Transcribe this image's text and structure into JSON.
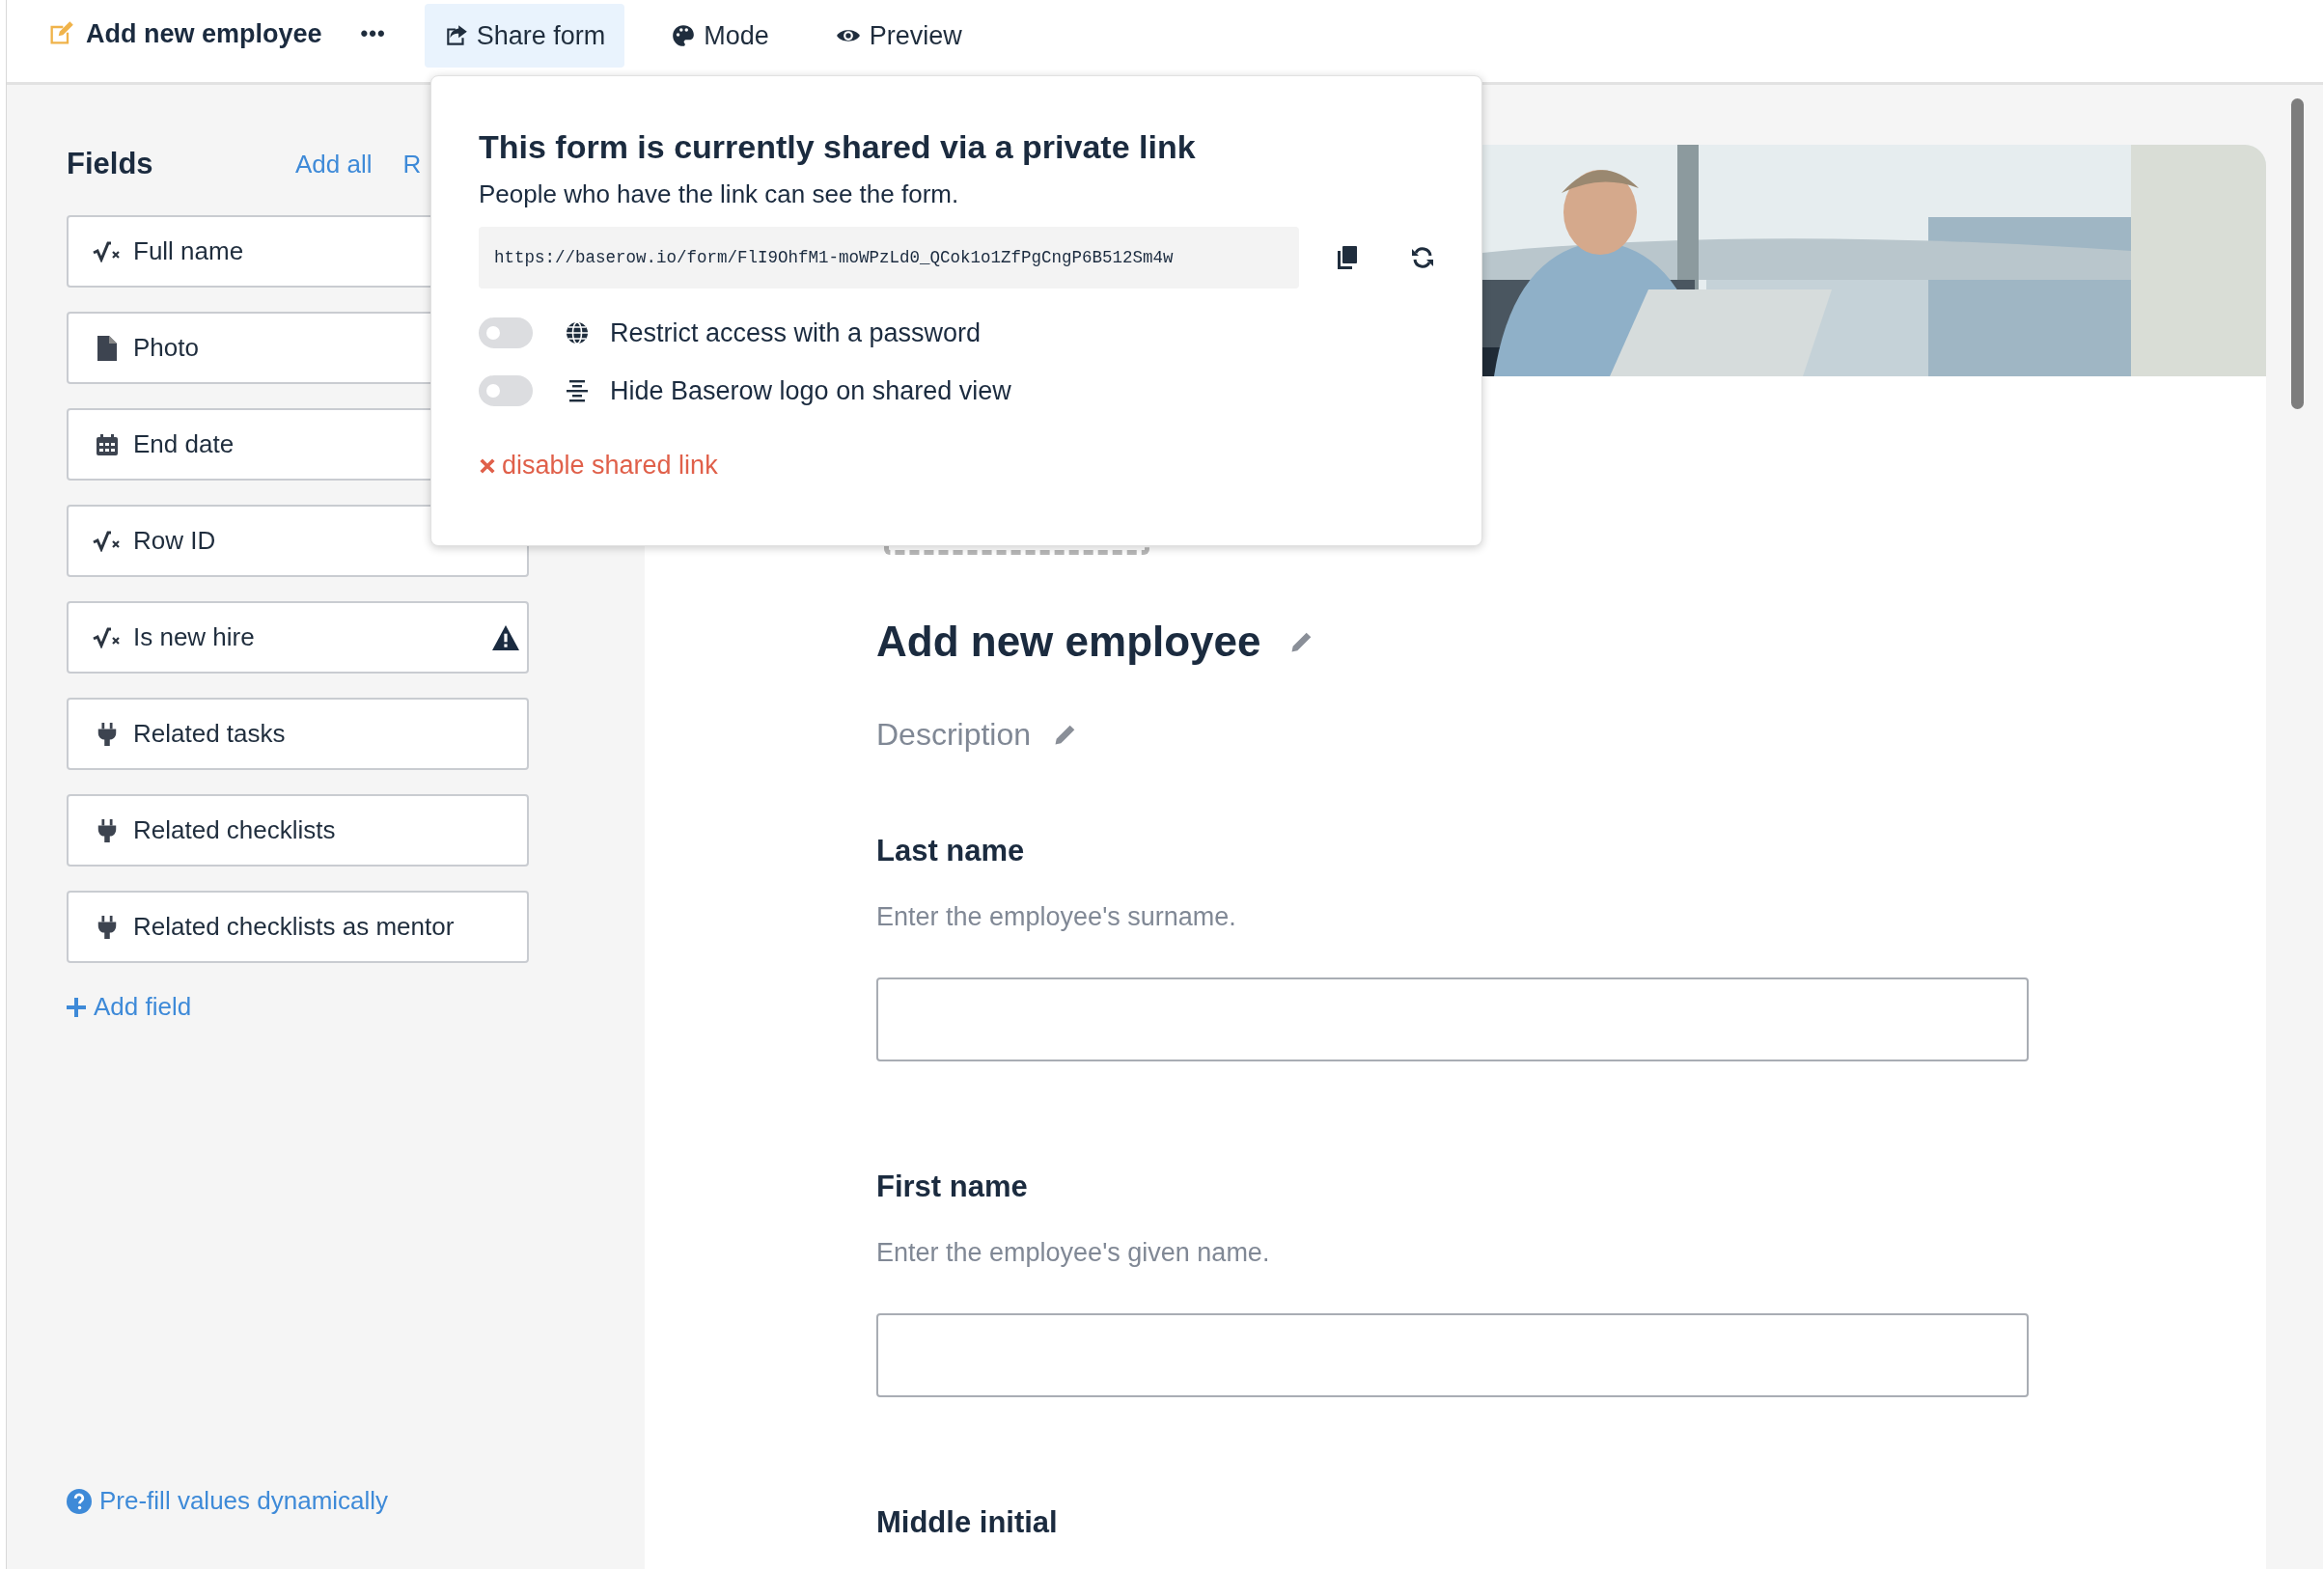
{
  "toolbar": {
    "title": "Add new employee",
    "more": "•••",
    "items": [
      {
        "label": "Share form",
        "selected": true
      },
      {
        "label": "Mode",
        "selected": false
      },
      {
        "label": "Preview",
        "selected": false
      }
    ]
  },
  "sidebar": {
    "heading": "Fields",
    "add_all": "Add all",
    "remove_all": "R",
    "fields": [
      {
        "name": "Full name",
        "kind": "formula"
      },
      {
        "name": "Photo",
        "kind": "file"
      },
      {
        "name": "End date",
        "kind": "date"
      },
      {
        "name": "Row ID",
        "kind": "formula"
      },
      {
        "name": "Is new hire",
        "kind": "formula",
        "warning": true
      },
      {
        "name": "Related tasks",
        "kind": "link",
        "warning": false
      },
      {
        "name": "Related checklists",
        "kind": "link",
        "warning": false
      },
      {
        "name": "Related checklists as mentor",
        "kind": "link",
        "warning": false
      }
    ],
    "add_field": "Add field",
    "prefill": "Pre-fill values dynamically"
  },
  "share_popup": {
    "title": "This form is currently shared via a private link",
    "subtitle": "People who have the link can see the form.",
    "url": "https://baserow.io/form/FlI9OhfM1-moWPzLd0_QCok1o1ZfPgCngP6B512Sm4w",
    "options": [
      {
        "label": "Restrict access with a password",
        "on": false
      },
      {
        "label": "Hide Baserow logo on shared view",
        "on": false
      }
    ],
    "disable": "disable shared link"
  },
  "form": {
    "title": "Add new employee",
    "description": "Description",
    "fields": [
      {
        "name": "Last name",
        "help": "Enter the employee's surname."
      },
      {
        "name": "First name",
        "help": "Enter the employee's given name."
      },
      {
        "name": "Middle initial"
      }
    ]
  }
}
